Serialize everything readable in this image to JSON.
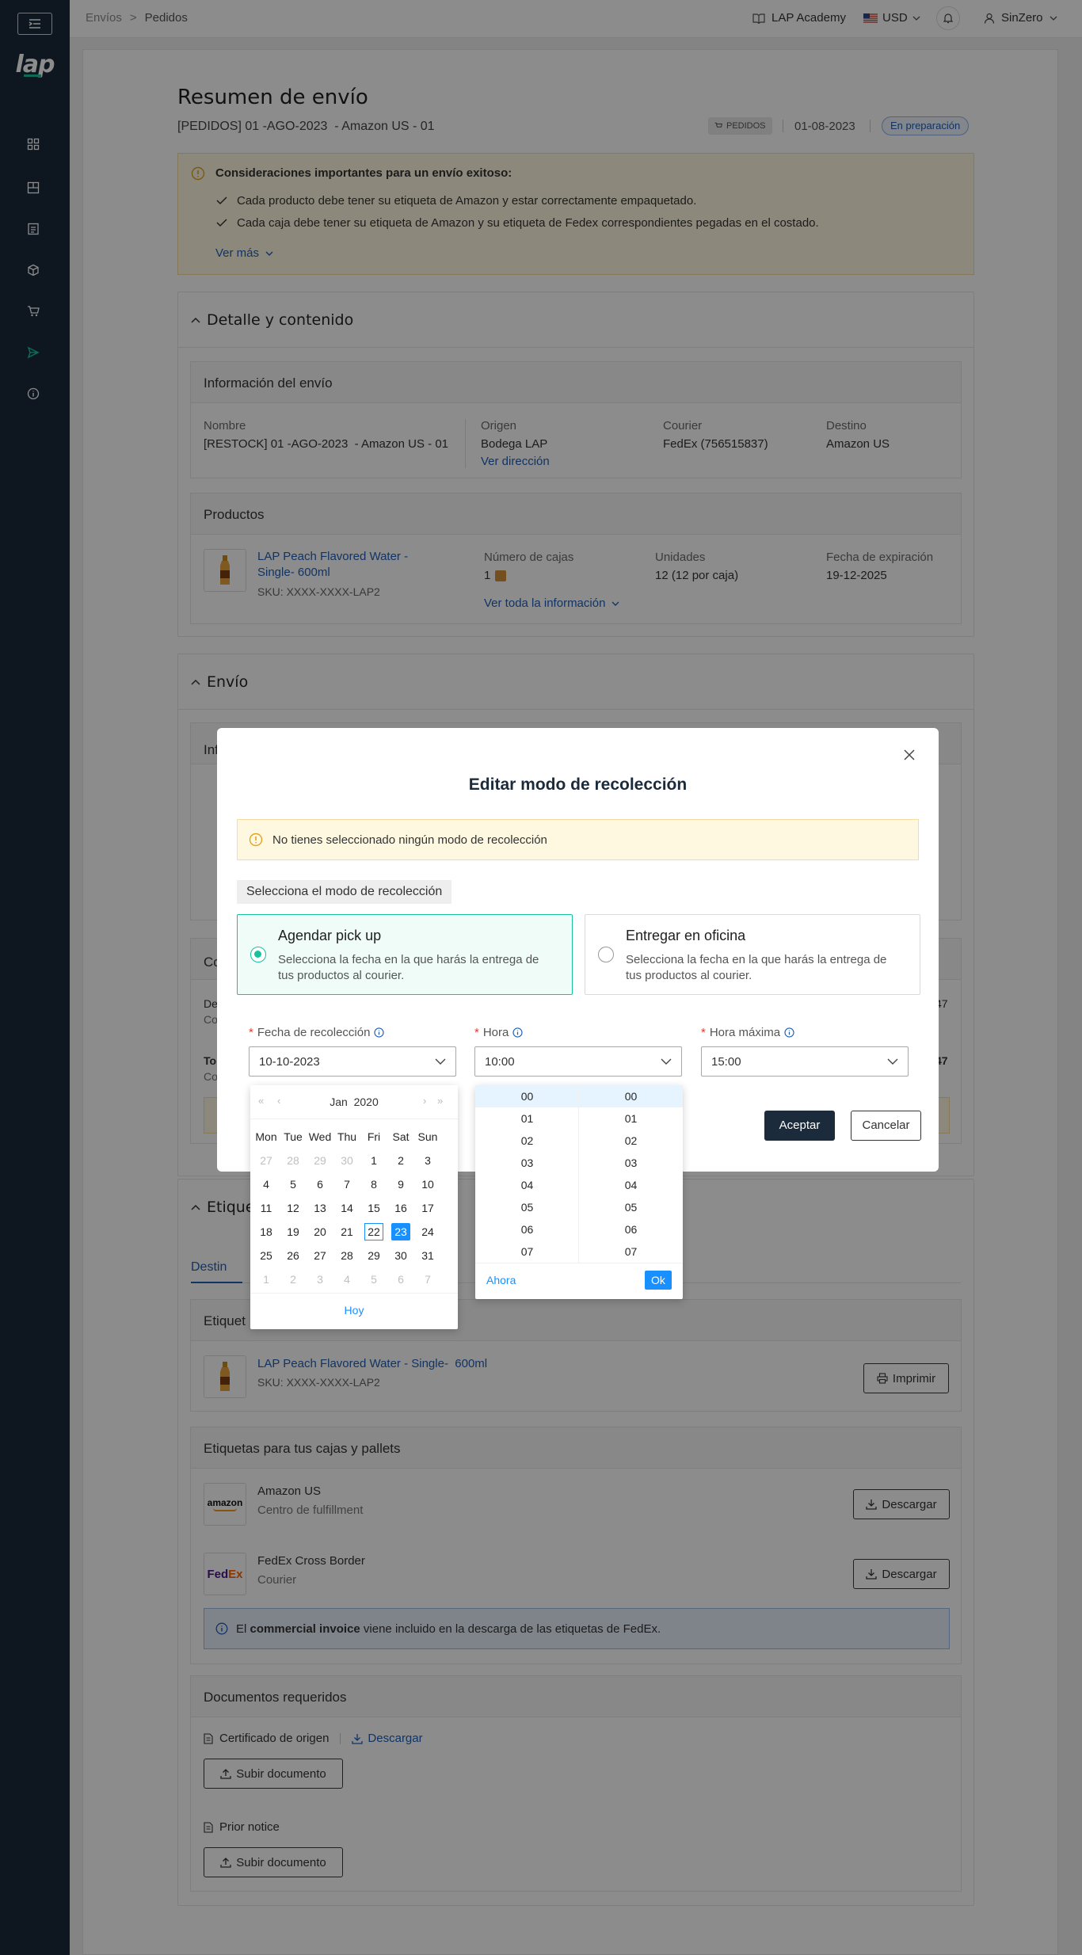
{
  "topbar": {
    "crumb1": "Envíos",
    "crumb_sep": ">",
    "crumb2": "Pedidos",
    "academy": "LAP Academy",
    "currency": "USD",
    "user": "SinZero"
  },
  "brand": {
    "logo": "lap"
  },
  "sidebar_icons": [
    "dashboard-icon",
    "inventory-icon",
    "document-icon",
    "box-icon",
    "cart-icon",
    "send-icon",
    "info-icon"
  ],
  "header": {
    "title": "Resumen de envío",
    "subtitle": "[PEDIDOS] 01 -AGO-2023  - Amazon US - 01",
    "tag": "PEDIDOS",
    "date": "01-08-2023",
    "status": "En preparación"
  },
  "alert": {
    "title": "Consideraciones importantes para un envío exitoso:",
    "items": [
      "Cada producto debe tener su etiqueta de Amazon y estar correctamente empaquetado.",
      "Cada caja debe tener su etiqueta de Amazon y su etiqueta de Fedex correspondientes pegadas en el costado."
    ],
    "more": "Ver más"
  },
  "detalle": {
    "title": "Detalle y contenido",
    "info_title": "Información del envío",
    "nombre_lbl": "Nombre",
    "nombre": "[RESTOCK] 01 -AGO-2023  - Amazon US - 01",
    "origen_lbl": "Origen",
    "origen": "Bodega LAP",
    "ver_dir": "Ver dirección",
    "courier_lbl": "Courier",
    "courier": "FedEx (756515837)",
    "destino_lbl": "Destino",
    "destino": "Amazon US",
    "productos_title": "Productos",
    "prod_name": "LAP Peach Flavored Water - Single-  600ml",
    "prod_sku": "SKU: XXXX-XXXX-LAP2",
    "cajas_lbl": "Número de cajas",
    "cajas": "1",
    "unidades_lbl": "Unidades",
    "unidades": "12 (12 por caja)",
    "exp_lbl": "Fecha de expiración",
    "exp": "19-12-2025",
    "ver_toda": "Ver toda la información"
  },
  "envio": {
    "title": "Envío",
    "info_partial": "Inf",
    "co_partial": "Co",
    "de_partial": "De",
    "co2_partial": "Co",
    "to_partial": "To",
    "co3_partial": "Co",
    "n47a": "47",
    "n47b": "47"
  },
  "etiquetas": {
    "title_partial": "Etique",
    "tab_partial": "Destin",
    "et_partial": "Etiquet",
    "prod_name": "LAP Peach Flavored Water - Single-  600ml",
    "prod_sku": "SKU: XXXX-XXXX-LAP2",
    "imprimir": "Imprimir",
    "cajas_title": "Etiquetas para tus cajas y pallets",
    "amazon_name": "Amazon US",
    "amazon_sub": "Centro de fulfillment",
    "amazon_logo": "amazon",
    "fedex_name": "FedEx Cross Border",
    "fedex_sub": "Courier",
    "fedex_logo_a": "Fed",
    "fedex_logo_b": "Ex",
    "descargar": "Descargar",
    "invoice_pre": "El ",
    "invoice_bold": "commercial invoice",
    "invoice_post": " viene incluido en la descarga de las etiquetas de FedEx."
  },
  "documentos": {
    "title": "Documentos requeridos",
    "cert": "Certificado de origen",
    "descargar": "Descargar",
    "subir": "Subir documento",
    "prior": "Prior notice"
  },
  "modal": {
    "title": "Editar modo de recolección",
    "warning": "No tienes seleccionado ningún modo de recolección",
    "select_label": "Selecciona el modo de recolección",
    "opt1_title": "Agendar pick up",
    "opt1_desc": "Selecciona la fecha en la que harás la entrega de tus productos al courier.",
    "opt2_title": "Entregar en oficina",
    "opt2_desc": "Selecciona la fecha en la que harás la entrega de tus productos al courier.",
    "fecha_lbl": "Fecha de recolección",
    "fecha_val": "10-10-2023",
    "hora_lbl": "Hora",
    "hora_val": "10:00",
    "horamax_lbl": "Hora máxima",
    "horamax_val": "15:00",
    "aceptar": "Aceptar",
    "cancelar": "Cancelar",
    "required_mark": "*"
  },
  "calendar": {
    "month": "Jan",
    "year": "2020",
    "weekdays": [
      "Mon",
      "Tue",
      "Wed",
      "Thu",
      "Fri",
      "Sat",
      "Sun"
    ],
    "weeks": [
      [
        "27",
        "28",
        "29",
        "30",
        "1",
        "2",
        "3"
      ],
      [
        "4",
        "5",
        "6",
        "7",
        "8",
        "9",
        "10"
      ],
      [
        "11",
        "12",
        "13",
        "14",
        "15",
        "16",
        "17"
      ],
      [
        "18",
        "19",
        "20",
        "21",
        "22",
        "23",
        "24"
      ],
      [
        "25",
        "26",
        "27",
        "28",
        "29",
        "30",
        "31"
      ],
      [
        "1",
        "2",
        "3",
        "4",
        "5",
        "6",
        "7"
      ]
    ],
    "today": "22",
    "selected": "23",
    "hoy": "Hoy"
  },
  "timepicker": {
    "hours": [
      "00",
      "01",
      "02",
      "03",
      "04",
      "05",
      "06",
      "07"
    ],
    "minutes": [
      "00",
      "01",
      "02",
      "03",
      "04",
      "05",
      "06",
      "07"
    ],
    "ahora": "Ahora",
    "ok": "Ok"
  },
  "colors": {
    "sidebar": "#1b2b3b",
    "accent_green": "#18c29c",
    "link": "#1f5fb8",
    "primary_blue": "#1890ff",
    "dark_btn": "#1b2b3b"
  }
}
